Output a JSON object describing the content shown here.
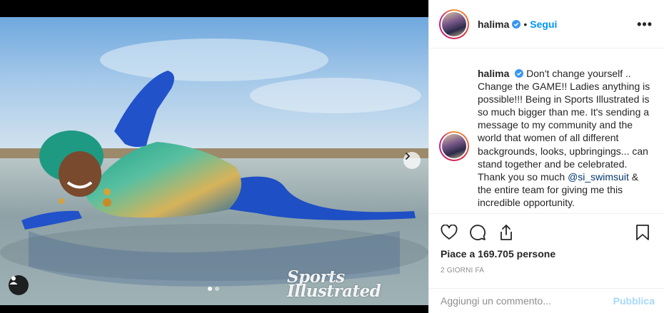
{
  "post": {
    "username": "halima",
    "follow_label": "Segui",
    "separator": "•",
    "more_label": "•••",
    "verified_icon": "verified-badge-icon",
    "caption": {
      "username": "halima",
      "text_before_mention": "Don't change yourself .. Change the GAME!! Ladies anything is possible!!! Being in Sports Illustrated is so much bigger than me. It's sending a message to my community and the world that women of all different backgrounds, looks, upbringings... can stand together and be celebrated. Thank you so much",
      "mention": "@si_swimsuit",
      "text_after_mention": "& the entire team for giving me this incredible opportunity."
    },
    "likes_text": "Piace a 169.705 persone",
    "timestamp": "2 GIORNI FA",
    "comment_placeholder": "Aggiungi un commento...",
    "publish_label": "Pubblica"
  },
  "media": {
    "watermark_line1": "Sports",
    "watermark_line2": "Illustrated",
    "carousel_total": 2,
    "carousel_current": 1,
    "icons": {
      "next": "chevron-right-icon",
      "user_tag": "person-icon"
    }
  },
  "actions": {
    "like_icon": "heart-icon",
    "comment_icon": "comment-icon",
    "share_icon": "share-icon",
    "save_icon": "bookmark-icon"
  },
  "colors": {
    "link": "#0095f6",
    "mention": "#00376b",
    "muted": "#8e8e8e",
    "text": "#262626"
  }
}
